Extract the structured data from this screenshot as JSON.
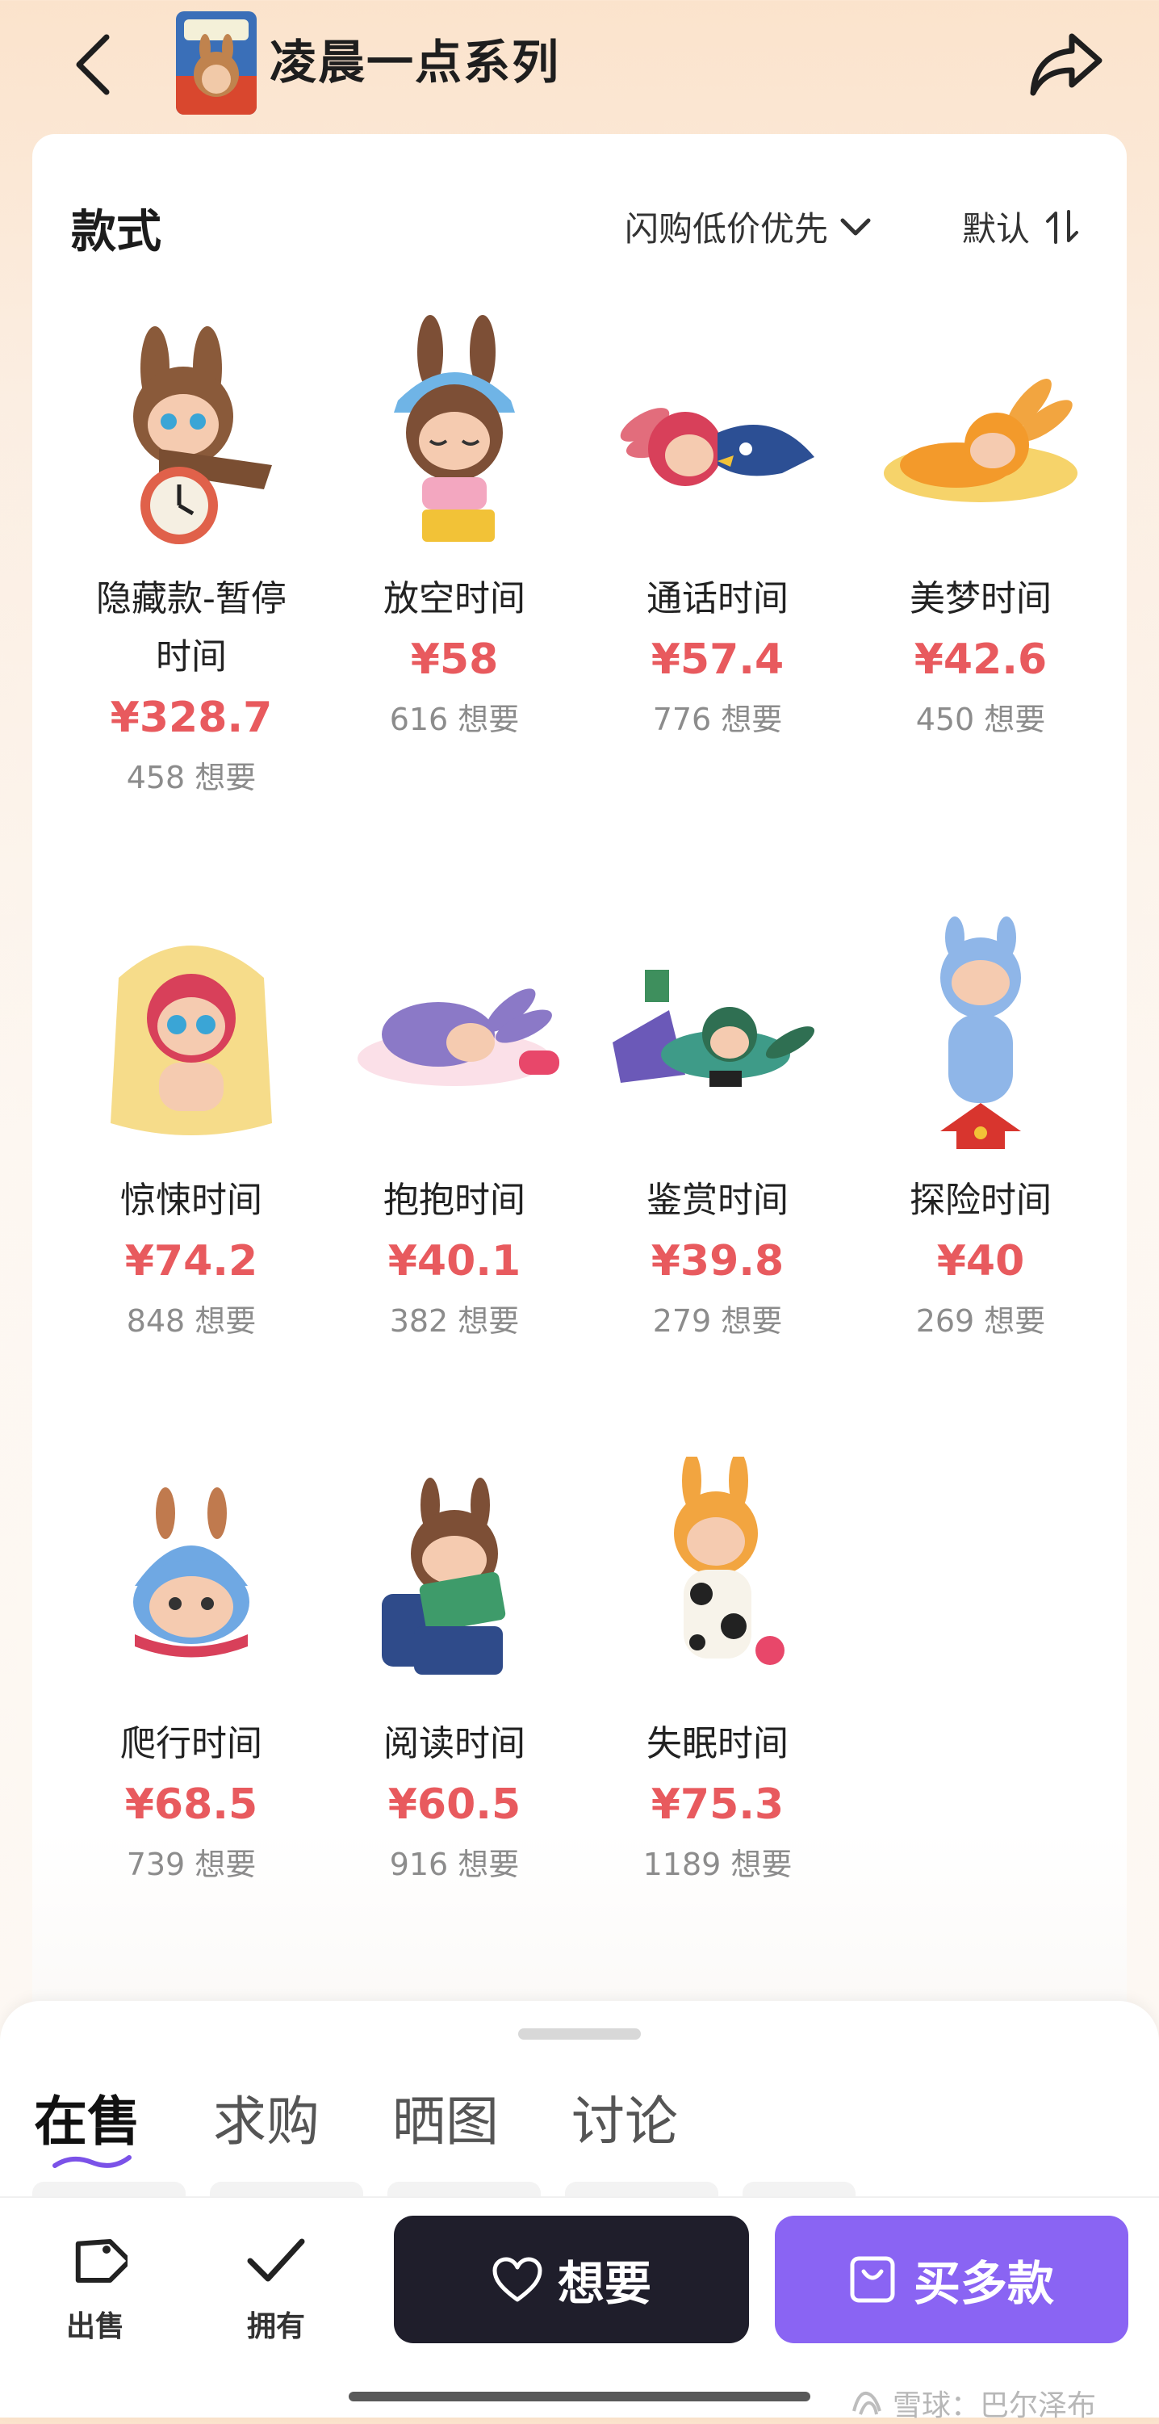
{
  "header": {
    "title": "凌晨一点系列",
    "back_icon": "chevron-left-icon",
    "share_icon": "share-arrow-icon"
  },
  "styles_panel": {
    "heading": "款式",
    "filter_label": "闪购低价优先",
    "sort_label": "默认"
  },
  "items": [
    {
      "name": "隐藏款-暂停时间",
      "price": "¥328.7",
      "want": "458 想要"
    },
    {
      "name": "放空时间",
      "price": "¥58",
      "want": "616 想要"
    },
    {
      "name": "通话时间",
      "price": "¥57.4",
      "want": "776 想要"
    },
    {
      "name": "美梦时间",
      "price": "¥42.6",
      "want": "450 想要"
    },
    {
      "name": "惊悚时间",
      "price": "¥74.2",
      "want": "848 想要"
    },
    {
      "name": "抱抱时间",
      "price": "¥40.1",
      "want": "382 想要"
    },
    {
      "name": "鉴赏时间",
      "price": "¥39.8",
      "want": "279 想要"
    },
    {
      "name": "探险时间",
      "price": "¥40",
      "want": "269 想要"
    },
    {
      "name": "爬行时间",
      "price": "¥68.5",
      "want": "739 想要"
    },
    {
      "name": "阅读时间",
      "price": "¥60.5",
      "want": "916 想要"
    },
    {
      "name": "失眠时间",
      "price": "¥75.3",
      "want": "1189 想要"
    }
  ],
  "tabs": [
    {
      "label": "在售",
      "active": true
    },
    {
      "label": "求购",
      "active": false
    },
    {
      "label": "晒图",
      "active": false
    },
    {
      "label": "讨论",
      "active": false
    }
  ],
  "actions": {
    "sell_label": "出售",
    "own_label": "拥有",
    "want_label": "想要",
    "buy_label": "买多款"
  },
  "watermark": "雪球：巴尔泽布",
  "colors": {
    "price": "#e85a5e",
    "primary_dark": "#1f1e2b",
    "accent_purple": "#8a64f3"
  }
}
